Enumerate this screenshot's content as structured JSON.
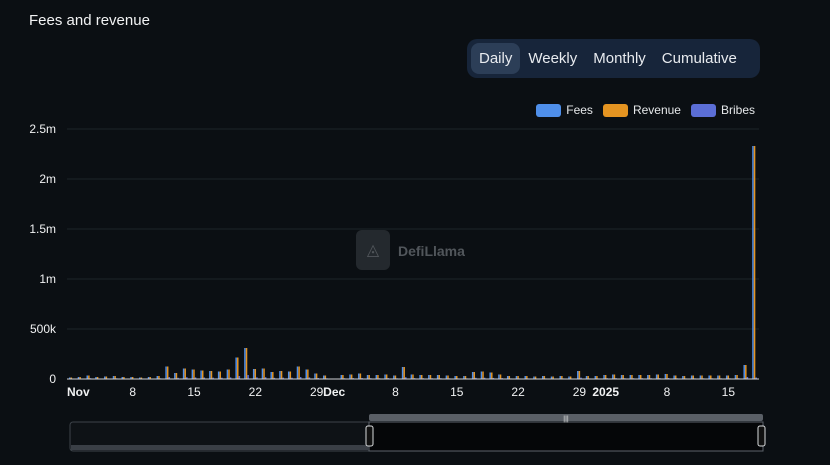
{
  "header": {
    "title": "Fees and revenue"
  },
  "tabs": [
    {
      "label": "Daily",
      "active": true
    },
    {
      "label": "Weekly",
      "active": false
    },
    {
      "label": "Monthly",
      "active": false
    },
    {
      "label": "Cumulative",
      "active": false
    }
  ],
  "watermark": "DefiLlama",
  "colors": {
    "fees": "#4f8fea",
    "revenue": "#e59421",
    "bribes": "#5b6ed6"
  },
  "chart_data": {
    "type": "bar",
    "legend": [
      "Fees",
      "Revenue",
      "Bribes"
    ],
    "legend_position": "top-right",
    "grid": true,
    "yticks": [
      "0",
      "500k",
      "1m",
      "1.5m",
      "2m",
      "2.5m"
    ],
    "ylim": [
      0,
      2500000
    ],
    "xticks": [
      "Nov",
      "8",
      "15",
      "22",
      "29",
      "Dec",
      "8",
      "15",
      "22",
      "29",
      "2025",
      "8",
      "15"
    ],
    "x": [
      "Nov 1",
      "Nov 2",
      "Nov 3",
      "Nov 4",
      "Nov 5",
      "Nov 6",
      "Nov 7",
      "Nov 8",
      "Nov 9",
      "Nov 10",
      "Nov 11",
      "Nov 12",
      "Nov 13",
      "Nov 14",
      "Nov 15",
      "Nov 16",
      "Nov 17",
      "Nov 18",
      "Nov 19",
      "Nov 20",
      "Nov 21",
      "Nov 22",
      "Nov 23",
      "Nov 24",
      "Nov 25",
      "Nov 26",
      "Nov 27",
      "Nov 28",
      "Nov 29",
      "Nov 30",
      "Dec 1",
      "Dec 2",
      "Dec 3",
      "Dec 4",
      "Dec 5",
      "Dec 6",
      "Dec 7",
      "Dec 8",
      "Dec 9",
      "Dec 10",
      "Dec 11",
      "Dec 12",
      "Dec 13",
      "Dec 14",
      "Dec 15",
      "Dec 16",
      "Dec 17",
      "Dec 18",
      "Dec 19",
      "Dec 20",
      "Dec 21",
      "Dec 22",
      "Dec 23",
      "Dec 24",
      "Dec 25",
      "Dec 26",
      "Dec 27",
      "Dec 28",
      "Dec 29",
      "Dec 30",
      "Dec 31",
      "Jan 1",
      "Jan 2",
      "Jan 3",
      "Jan 4",
      "Jan 5",
      "Jan 6",
      "Jan 7",
      "Jan 8",
      "Jan 9",
      "Jan 10",
      "Jan 11",
      "Jan 12",
      "Jan 13",
      "Jan 14",
      "Jan 15",
      "Jan 16",
      "Jan 17",
      "Jan 18"
    ],
    "series": [
      {
        "name": "Fees",
        "values": [
          15000,
          20000,
          35000,
          20000,
          25000,
          30000,
          20000,
          20000,
          15000,
          20000,
          30000,
          125000,
          60000,
          105000,
          95000,
          85000,
          80000,
          75000,
          95000,
          215000,
          310000,
          100000,
          105000,
          70000,
          80000,
          75000,
          125000,
          95000,
          55000,
          35000,
          0,
          40000,
          45000,
          55000,
          40000,
          40000,
          45000,
          35000,
          120000,
          45000,
          40000,
          40000,
          40000,
          35000,
          30000,
          30000,
          70000,
          75000,
          65000,
          45000,
          30000,
          30000,
          30000,
          25000,
          30000,
          25000,
          30000,
          25000,
          80000,
          30000,
          30000,
          40000,
          45000,
          40000,
          40000,
          40000,
          40000,
          45000,
          50000,
          35000,
          30000,
          35000,
          35000,
          35000,
          35000,
          35000,
          40000,
          140000,
          2330000
        ]
      },
      {
        "name": "Revenue",
        "values": [
          15000,
          20000,
          35000,
          20000,
          25000,
          30000,
          20000,
          20000,
          15000,
          20000,
          30000,
          125000,
          60000,
          105000,
          95000,
          85000,
          80000,
          75000,
          95000,
          215000,
          310000,
          100000,
          105000,
          70000,
          80000,
          75000,
          125000,
          95000,
          55000,
          35000,
          0,
          40000,
          45000,
          55000,
          40000,
          40000,
          45000,
          35000,
          120000,
          45000,
          40000,
          40000,
          40000,
          35000,
          30000,
          30000,
          70000,
          75000,
          65000,
          45000,
          30000,
          30000,
          30000,
          25000,
          30000,
          25000,
          30000,
          25000,
          80000,
          30000,
          30000,
          40000,
          45000,
          40000,
          40000,
          40000,
          40000,
          45000,
          50000,
          35000,
          30000,
          35000,
          35000,
          35000,
          35000,
          35000,
          40000,
          140000,
          2330000
        ]
      },
      {
        "name": "Bribes",
        "values": [
          5000,
          5000,
          8000,
          5000,
          6000,
          7000,
          5000,
          5000,
          4000,
          5000,
          7000,
          20000,
          12000,
          18000,
          16000,
          15000,
          14000,
          13000,
          16000,
          30000,
          40000,
          17000,
          18000,
          12000,
          14000,
          13000,
          20000,
          16000,
          10000,
          7000,
          0,
          8000,
          9000,
          10000,
          8000,
          8000,
          9000,
          7000,
          18000,
          9000,
          8000,
          8000,
          8000,
          7000,
          6000,
          6000,
          12000,
          13000,
          11000,
          9000,
          6000,
          6000,
          6000,
          5000,
          6000,
          5000,
          6000,
          5000,
          14000,
          6000,
          6000,
          8000,
          9000,
          8000,
          8000,
          8000,
          8000,
          9000,
          10000,
          7000,
          6000,
          7000,
          7000,
          7000,
          7000,
          7000,
          8000,
          20000,
          15000
        ]
      }
    ]
  }
}
